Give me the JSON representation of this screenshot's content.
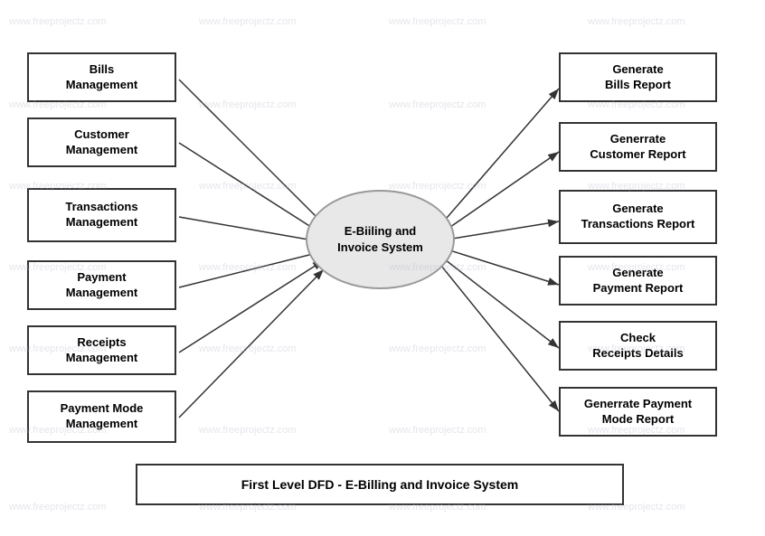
{
  "diagram": {
    "title": "First Level DFD - E-Billing and Invoice System",
    "center": {
      "label": "E-Biiling and\nInvoice System"
    },
    "left_nodes": [
      {
        "id": "bills-mgmt",
        "label": "Bills\nManagement"
      },
      {
        "id": "customer-mgmt",
        "label": "Customer\nManagement"
      },
      {
        "id": "transactions-mgmt",
        "label": "Transactions\nManagement"
      },
      {
        "id": "payment-mgmt",
        "label": "Payment\nManagement"
      },
      {
        "id": "receipts-mgmt",
        "label": "Receipts\nManagement"
      },
      {
        "id": "payment-mode-mgmt",
        "label": "Payment Mode\nManagement"
      }
    ],
    "right_nodes": [
      {
        "id": "gen-bills",
        "label": "Generate\nBills Report"
      },
      {
        "id": "gen-customer",
        "label": "Generrate\nCustomer Report"
      },
      {
        "id": "gen-transactions",
        "label": "Generate\nTransactions Report"
      },
      {
        "id": "gen-payment",
        "label": "Generate\nPayment Report"
      },
      {
        "id": "check-receipts",
        "label": "Check\nReceipts Details"
      },
      {
        "id": "gen-payment-mode",
        "label": "Generrate Payment\nMode Report"
      }
    ]
  },
  "watermarks": [
    "www.freeprojectz.com",
    "www.freeprojectz.com",
    "www.freeprojectz.com",
    "www.freeprojectz.com"
  ]
}
